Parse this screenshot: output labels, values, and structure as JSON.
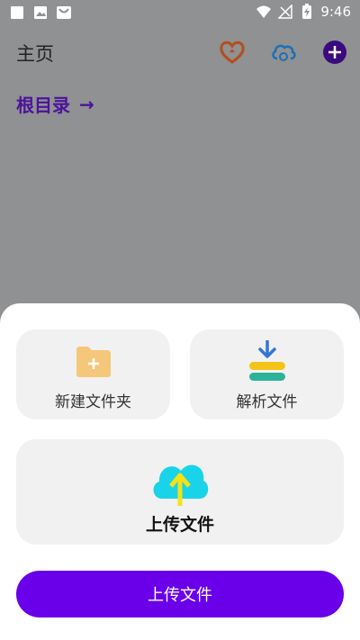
{
  "status_bar": {
    "time": "9:46",
    "left_icons": [
      "square-icon",
      "image-icon",
      "shop-icon"
    ],
    "right_icons": [
      "wifi-icon",
      "no-signal-icon",
      "battery-charging-icon"
    ]
  },
  "header": {
    "title": "主页",
    "actions": [
      "heart-icon",
      "cloud-sync-icon",
      "add-icon"
    ]
  },
  "breadcrumb": {
    "label": "根目录",
    "arrow": "→"
  },
  "sheet": {
    "new_folder_label": "新建文件夹",
    "parse_file_label": "解析文件",
    "upload_card_label": "上传文件",
    "upload_button_label": "上传文件"
  },
  "colors": {
    "accent": "#6a00ea",
    "breadcrumb": "#4b139b",
    "overlay_bg": "#8f9192",
    "card_bg": "#f1f1f1",
    "folder": "#f5c77a",
    "cloud": "#19d3e9",
    "arrow_yellow": "#f6e117"
  }
}
